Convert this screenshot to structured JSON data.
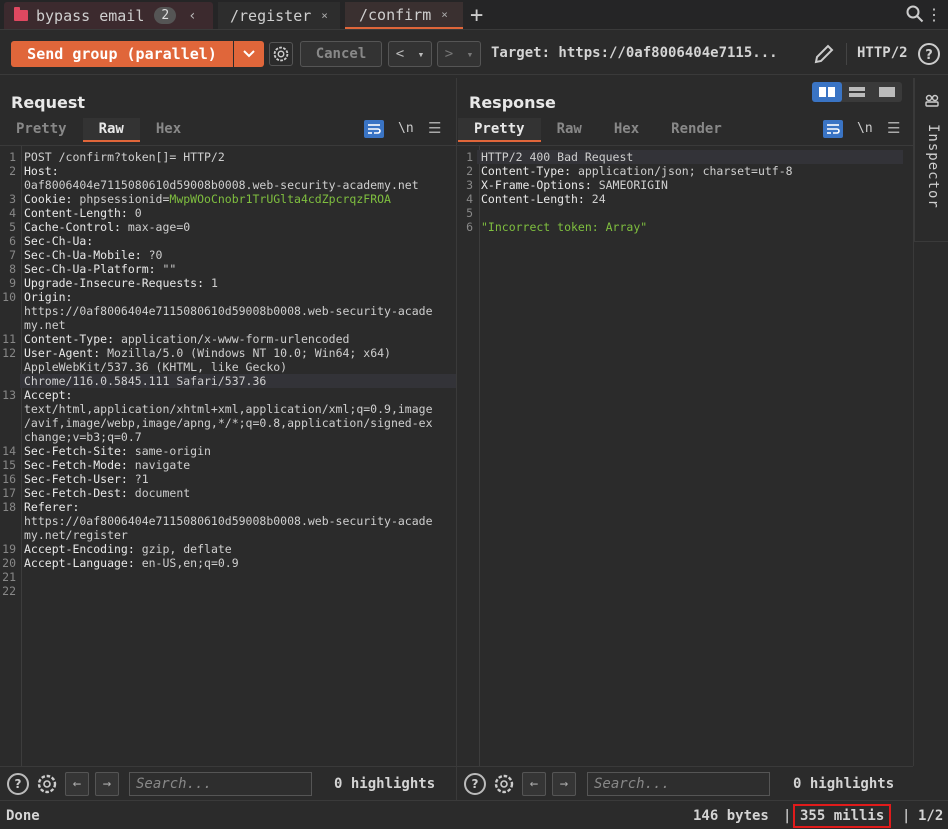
{
  "tabs": {
    "group": {
      "label": "bypass email",
      "count": "2",
      "chevron": "‹"
    },
    "items": [
      {
        "label": "/register",
        "close": "×"
      },
      {
        "label": "/confirm",
        "close": "×"
      }
    ],
    "plus": "+"
  },
  "toolbar": {
    "send_label": "Send group (parallel)",
    "cancel_label": "Cancel",
    "back": "<",
    "fwd": ">",
    "drop": "▾",
    "target": "Target: https://0af8006404e7115...",
    "protocol": "HTTP/2"
  },
  "request": {
    "title": "Request",
    "tabs": [
      "Pretty",
      "Raw",
      "Hex"
    ],
    "active_tab": "Raw",
    "newline_label": "\\n",
    "lines": [
      {
        "n": "1",
        "name": "",
        "value": "POST /confirm?token[]= HTTP/2"
      },
      {
        "n": "2",
        "name": "Host:",
        "value": ""
      },
      {
        "n": "",
        "name": "",
        "value": "0af8006404e7115080610d59008b0008.web-security-academy.net"
      },
      {
        "n": "3",
        "name": "Cookie:",
        "value": " phpsessionid=",
        "green": "MwpWOoCnobr1TrUGlta4cdZpcrqzFROA"
      },
      {
        "n": "4",
        "name": "Content-Length:",
        "value": " 0"
      },
      {
        "n": "5",
        "name": "Cache-Control:",
        "value": " max-age=0"
      },
      {
        "n": "6",
        "name": "Sec-Ch-Ua:",
        "value": ""
      },
      {
        "n": "7",
        "name": "Sec-Ch-Ua-Mobile:",
        "value": " ?0"
      },
      {
        "n": "8",
        "name": "Sec-Ch-Ua-Platform:",
        "value": " \"\""
      },
      {
        "n": "9",
        "name": "Upgrade-Insecure-Requests:",
        "value": " 1"
      },
      {
        "n": "10",
        "name": "Origin:",
        "value": ""
      },
      {
        "n": "",
        "name": "",
        "value": "https://0af8006404e7115080610d59008b0008.web-security-acade"
      },
      {
        "n": "",
        "name": "",
        "value": "my.net"
      },
      {
        "n": "11",
        "name": "Content-Type:",
        "value": " application/x-www-form-urlencoded"
      },
      {
        "n": "12",
        "name": "User-Agent:",
        "value": " Mozilla/5.0 (Windows NT 10.0; Win64; x64)"
      },
      {
        "n": "",
        "name": "",
        "value": "AppleWebKit/537.36 (KHTML, like Gecko)"
      },
      {
        "n": "",
        "name": "",
        "value": "Chrome/116.0.5845.111 Safari/537.36",
        "hl": true
      },
      {
        "n": "13",
        "name": "Accept:",
        "value": ""
      },
      {
        "n": "",
        "name": "",
        "value": "text/html,application/xhtml+xml,application/xml;q=0.9,image"
      },
      {
        "n": "",
        "name": "",
        "value": "/avif,image/webp,image/apng,*/*;q=0.8,application/signed-ex"
      },
      {
        "n": "",
        "name": "",
        "value": "change;v=b3;q=0.7"
      },
      {
        "n": "14",
        "name": "Sec-Fetch-Site:",
        "value": " same-origin"
      },
      {
        "n": "15",
        "name": "Sec-Fetch-Mode:",
        "value": " navigate"
      },
      {
        "n": "16",
        "name": "Sec-Fetch-User:",
        "value": " ?1"
      },
      {
        "n": "17",
        "name": "Sec-Fetch-Dest:",
        "value": " document"
      },
      {
        "n": "18",
        "name": "Referer:",
        "value": ""
      },
      {
        "n": "",
        "name": "",
        "value": "https://0af8006404e7115080610d59008b0008.web-security-acade"
      },
      {
        "n": "",
        "name": "",
        "value": "my.net/register"
      },
      {
        "n": "19",
        "name": "Accept-Encoding:",
        "value": " gzip, deflate"
      },
      {
        "n": "20",
        "name": "Accept-Language:",
        "value": " en-US,en;q=0.9"
      },
      {
        "n": "21",
        "name": "",
        "value": ""
      },
      {
        "n": "22",
        "name": "",
        "value": ""
      }
    ],
    "search_placeholder": "Search...",
    "highlights": "0 highlights"
  },
  "response": {
    "title": "Response",
    "tabs": [
      "Pretty",
      "Raw",
      "Hex",
      "Render"
    ],
    "active_tab": "Pretty",
    "newline_label": "\\n",
    "lines": [
      {
        "n": "1",
        "name": "",
        "value": "HTTP/2 400 Bad Request",
        "hl": true
      },
      {
        "n": "2",
        "name": "Content-Type:",
        "value": " application/json; charset=utf-8"
      },
      {
        "n": "3",
        "name": "X-Frame-Options:",
        "value": " SAMEORIGIN"
      },
      {
        "n": "4",
        "name": "Content-Length:",
        "value": " 24"
      },
      {
        "n": "5",
        "name": "",
        "value": ""
      },
      {
        "n": "6",
        "name": "",
        "value": "",
        "green": "\"Incorrect token: Array\""
      }
    ],
    "search_placeholder": "Search...",
    "highlights": "0 highlights"
  },
  "inspector": {
    "label": "Inspector"
  },
  "status": {
    "text": "Done",
    "bytes": "146 bytes",
    "sep": "|",
    "millis": "355 millis",
    "page": "1/2"
  },
  "colors": {
    "accent": "#e0663a",
    "highlight_box": "#e01b1b",
    "blue": "#3a74c4"
  }
}
